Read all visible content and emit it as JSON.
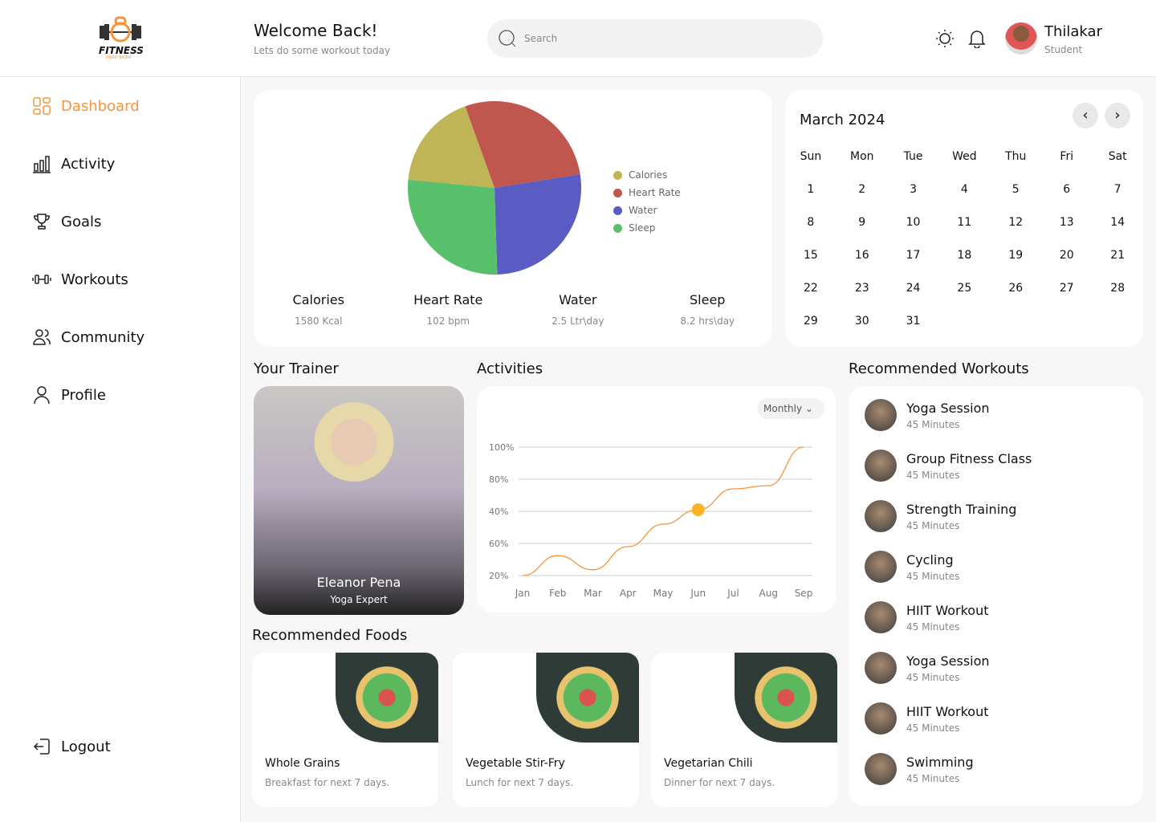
{
  "brand": {
    "name": "FITNESS",
    "tagline": "HARD WORK"
  },
  "header": {
    "title": "Welcome Back!",
    "subtitle": "Lets do some workout today",
    "search_placeholder": "Search",
    "user_name": "Thilakar",
    "user_role": "Student"
  },
  "sidebar": {
    "items": [
      {
        "label": "Dashboard"
      },
      {
        "label": "Activity"
      },
      {
        "label": "Goals"
      },
      {
        "label": "Workouts"
      },
      {
        "label": "Community"
      },
      {
        "label": "Profile"
      }
    ],
    "logout": "Logout"
  },
  "colors": {
    "accent": "#f7943a",
    "calories": "#bfb556",
    "heart": "#c0574f",
    "water": "#5a5bc3",
    "sleep": "#58c06b"
  },
  "stats": [
    {
      "label": "Calories",
      "value": "1580 Kcal"
    },
    {
      "label": "Heart Rate",
      "value": "102 bpm"
    },
    {
      "label": "Water",
      "value": "2.5 Ltr\\day"
    },
    {
      "label": "Sleep",
      "value": "8.2 hrs\\day"
    }
  ],
  "chart_data": [
    {
      "type": "pie",
      "categories": [
        "Calories",
        "Heart Rate",
        "Water",
        "Sleep"
      ],
      "values": [
        18,
        28,
        27,
        27
      ],
      "legend": "right"
    },
    {
      "type": "line",
      "title": "Activities",
      "x": [
        "Jan",
        "Feb",
        "Mar",
        "Apr",
        "May",
        "Jun",
        "Jul",
        "Aug",
        "Sep"
      ],
      "yticks": [
        "100%",
        "80%",
        "40%",
        "60%",
        "20%"
      ],
      "values": [
        0,
        0.62,
        0.18,
        0.9,
        1.6,
        2.05,
        2.7,
        2.8,
        4.0
      ],
      "highlight": "Jun",
      "filter": "Monthly"
    }
  ],
  "calendar": {
    "month": "March 2024",
    "days": [
      "Sun",
      "Mon",
      "Tue",
      "Wed",
      "Thu",
      "Fri",
      "Sat"
    ],
    "first_offset": 0,
    "num_days": 31
  },
  "trainer": {
    "section": "Your Trainer",
    "name": "Eleanor Pena",
    "role": "Yoga Expert"
  },
  "activities": {
    "section": "Activities"
  },
  "workouts": {
    "section": "Recommended Workouts",
    "items": [
      {
        "title": "Yoga Session",
        "sub": "45 Minutes"
      },
      {
        "title": "Group Fitness Class",
        "sub": "45 Minutes"
      },
      {
        "title": "Strength Training",
        "sub": "45 Minutes"
      },
      {
        "title": "Cycling",
        "sub": "45 Minutes"
      },
      {
        "title": "HIIT Workout",
        "sub": "45 Minutes"
      },
      {
        "title": "Yoga Session",
        "sub": "45 Minutes"
      },
      {
        "title": "HIIT Workout",
        "sub": "45 Minutes"
      },
      {
        "title": "Swimming",
        "sub": "45 Minutes"
      }
    ]
  },
  "foods": {
    "section": "Recommended Foods",
    "items": [
      {
        "title": "Whole Grains",
        "sub": "Breakfast for next 7 days."
      },
      {
        "title": "Vegetable Stir-Fry",
        "sub": "Lunch for next 7 days."
      },
      {
        "title": "Vegetarian Chili",
        "sub": "Dinner for next 7 days."
      }
    ]
  }
}
